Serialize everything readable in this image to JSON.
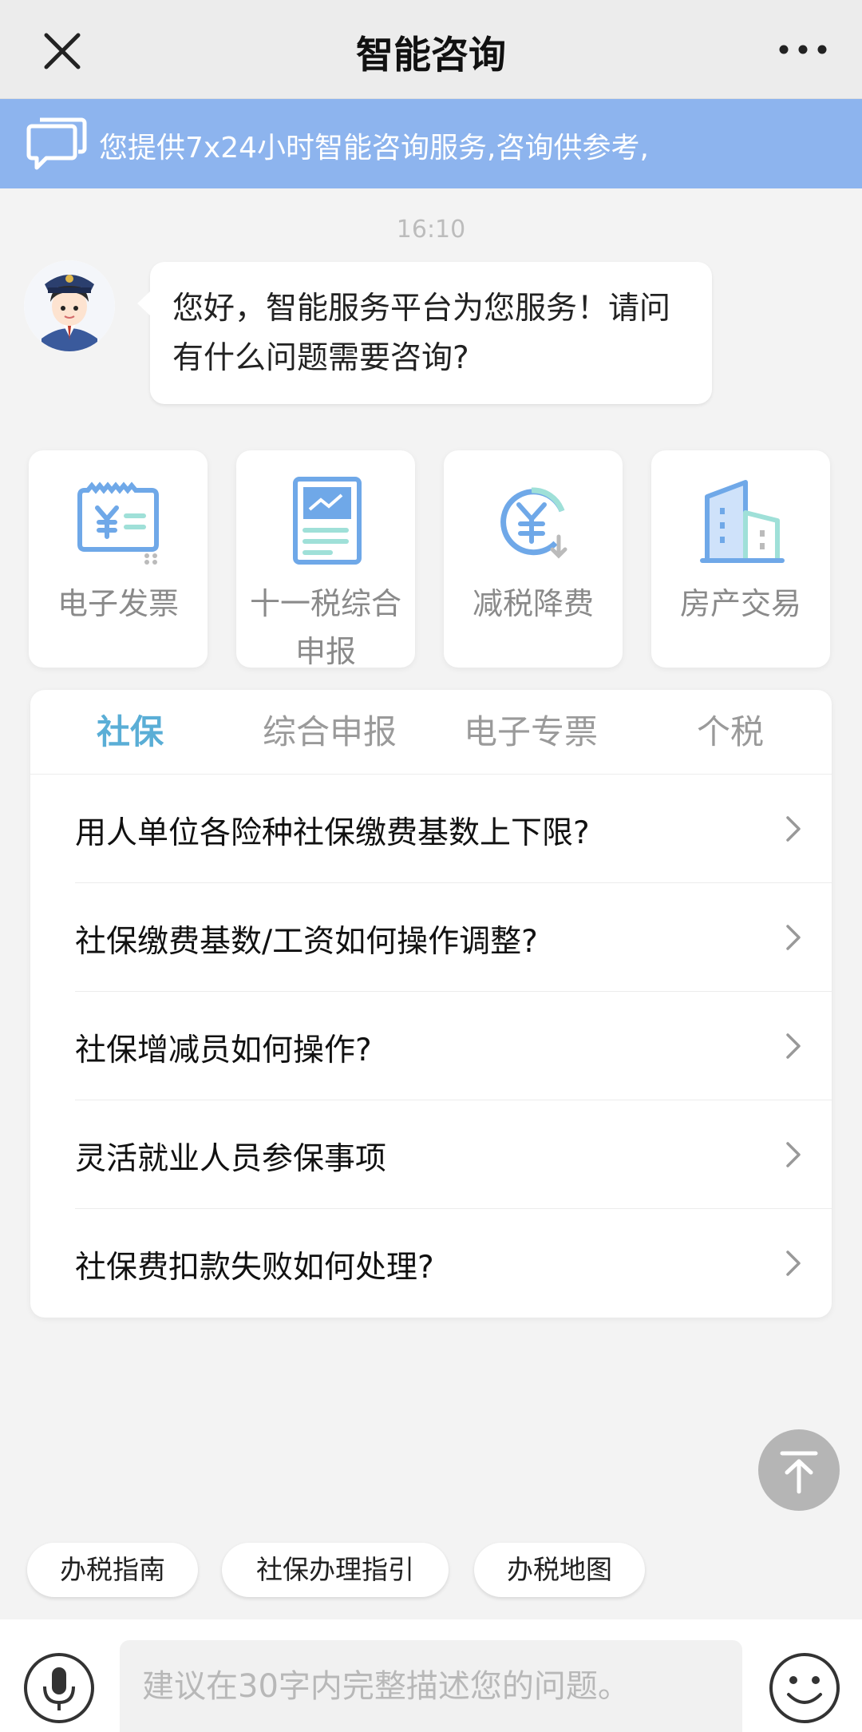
{
  "navbar": {
    "title": "智能咨询",
    "close_icon": "close-icon",
    "more_icon": "more-icon"
  },
  "notice": {
    "text": "您提供7x24小时智能咨询服务,咨询供参考,",
    "icon": "chat-bubbles-icon"
  },
  "chat": {
    "time": "16:10",
    "greeting": "您好，智能服务平台为您服务！请问有什么问题需要咨询?"
  },
  "service_cards": [
    {
      "label": "电子发票",
      "icon": "invoice-icon"
    },
    {
      "label": "十一税综合申报",
      "icon": "tax-report-icon"
    },
    {
      "label": "减税降费",
      "icon": "tax-reduction-icon"
    },
    {
      "label": "房产交易",
      "icon": "building-icon"
    }
  ],
  "tabs": [
    {
      "label": "社保",
      "active": true
    },
    {
      "label": "综合申报",
      "active": false
    },
    {
      "label": "电子专票",
      "active": false
    },
    {
      "label": "个税",
      "active": false
    }
  ],
  "questions": [
    "用人单位各险种社保缴费基数上下限?",
    "社保缴费基数/工资如何操作调整?",
    "社保增减员如何操作?",
    "灵活就业人员参保事项",
    "社保费扣款失败如何处理?"
  ],
  "quick_chips": [
    "办税指南",
    "社保办理指引",
    "办税地图"
  ],
  "input": {
    "placeholder": "建议在30字内完整描述您的问题。",
    "value": ""
  },
  "colors": {
    "notice_bg": "#8db4ee",
    "tab_active": "#5aaed6",
    "icon_blue": "#6fa8e8",
    "icon_teal": "#9fe0d8"
  }
}
